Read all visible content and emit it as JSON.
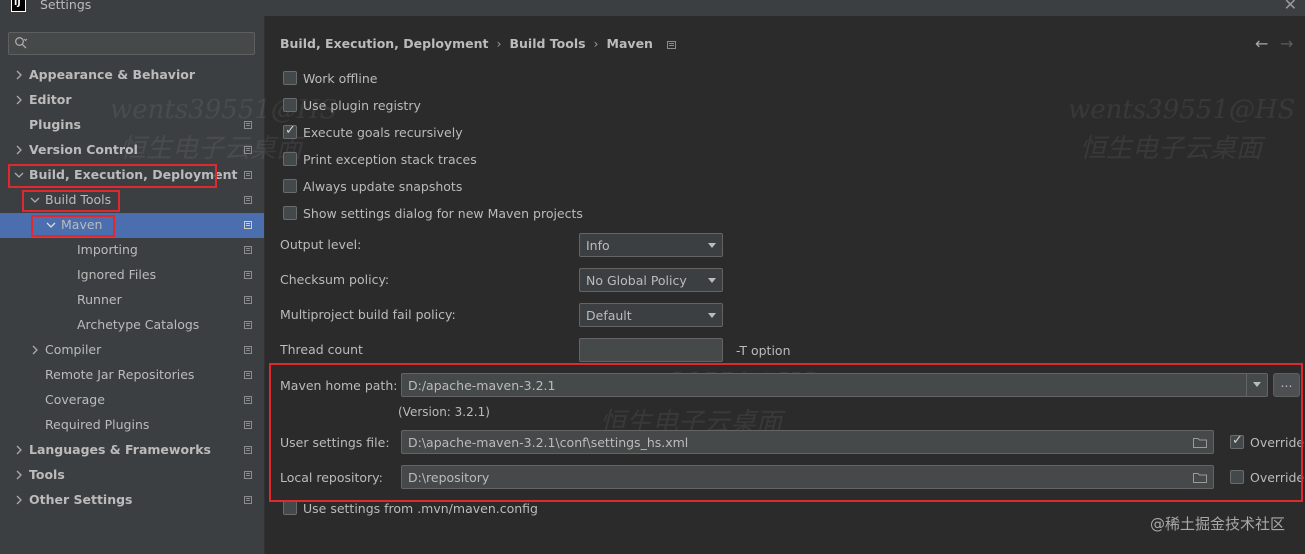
{
  "window": {
    "title": "Settings",
    "app_icon_text": "IJ"
  },
  "search": {
    "placeholder": ""
  },
  "sidebar": {
    "items": [
      {
        "label": "Appearance & Behavior"
      },
      {
        "label": "Editor"
      },
      {
        "label": "Plugins"
      },
      {
        "label": "Version Control"
      },
      {
        "label": "Build, Execution, Deployment"
      },
      {
        "label": "Build Tools"
      },
      {
        "label": "Maven"
      },
      {
        "label": "Importing"
      },
      {
        "label": "Ignored Files"
      },
      {
        "label": "Runner"
      },
      {
        "label": "Archetype Catalogs"
      },
      {
        "label": "Compiler"
      },
      {
        "label": "Remote Jar Repositories"
      },
      {
        "label": "Coverage"
      },
      {
        "label": "Required Plugins"
      },
      {
        "label": "Languages & Frameworks"
      },
      {
        "label": "Tools"
      },
      {
        "label": "Other Settings"
      }
    ]
  },
  "breadcrumb": {
    "part1": "Build, Execution, Deployment",
    "part2": "Build Tools",
    "part3": "Maven",
    "separator": "›"
  },
  "nav": {
    "back": "←",
    "forward": "→"
  },
  "options": {
    "work_offline": {
      "label": "Work offline",
      "checked": false
    },
    "use_plugin_registry": {
      "label": "Use plugin registry",
      "checked": false
    },
    "execute_goals_recursively": {
      "label": "Execute goals recursively",
      "checked": true
    },
    "print_exception_stack_traces": {
      "label": "Print exception stack traces",
      "checked": false
    },
    "always_update_snapshots": {
      "label": "Always update snapshots",
      "checked": false
    },
    "show_settings_dialog": {
      "label": "Show settings dialog for new Maven projects",
      "checked": false
    },
    "use_mvn_config": {
      "label": "Use settings from .mvn/maven.config",
      "checked": false
    }
  },
  "fields": {
    "output_level": {
      "label": "Output level:",
      "value": "Info"
    },
    "checksum_policy": {
      "label": "Checksum policy:",
      "value": "No Global Policy"
    },
    "multiproject_fail_policy": {
      "label": "Multiproject build fail policy:",
      "value": "Default"
    },
    "thread_count": {
      "label": "Thread count",
      "value": "",
      "suffix": "-T option"
    },
    "maven_home": {
      "label": "Maven home path:",
      "value": "D:/apache-maven-3.2.1",
      "version": "(Version: 3.2.1)",
      "browse": "..."
    },
    "user_settings": {
      "label": "User settings file:",
      "value": "D:\\apache-maven-3.2.1\\conf\\settings_hs.xml",
      "override_label": "Override",
      "override": true
    },
    "local_repo": {
      "label": "Local repository:",
      "value": "D:\\repository",
      "override_label": "Override",
      "override": false
    }
  },
  "watermarks": {
    "user": "wents39551@HS",
    "company": "恒生电子云桌面",
    "site": "@稀土掘金技术社区"
  },
  "colors": {
    "selection": "#4b6eaf",
    "highlight_box": "#e0282e",
    "background": "#2b2b2b",
    "sidebar": "#3c3f41"
  }
}
